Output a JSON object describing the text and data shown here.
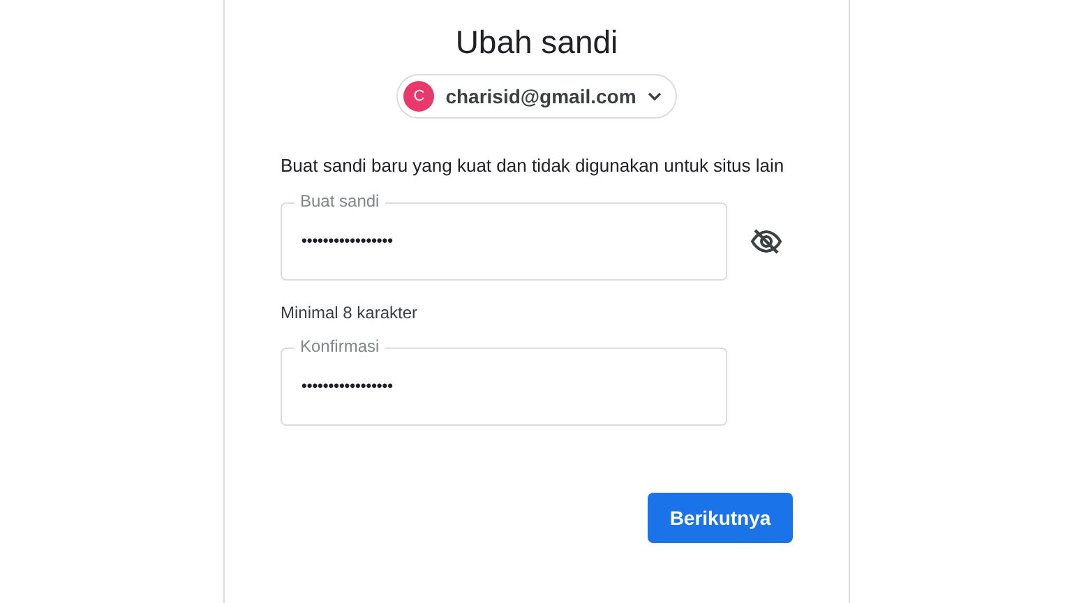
{
  "title": "Ubah sandi",
  "account": {
    "initial": "C",
    "email": "charisid@gmail.com"
  },
  "description": "Buat sandi baru yang kuat dan tidak digunakan untuk situs lain",
  "fields": [
    {
      "label": "Buat sandi",
      "value": "•••••••••••••••••",
      "kind": "with_toggle",
      "hint": "Minimal 8 karakter"
    },
    {
      "label": "Konfirmasi",
      "value": "•••••••••••••••••",
      "kind": "plain"
    }
  ],
  "button": "Berikutnya"
}
